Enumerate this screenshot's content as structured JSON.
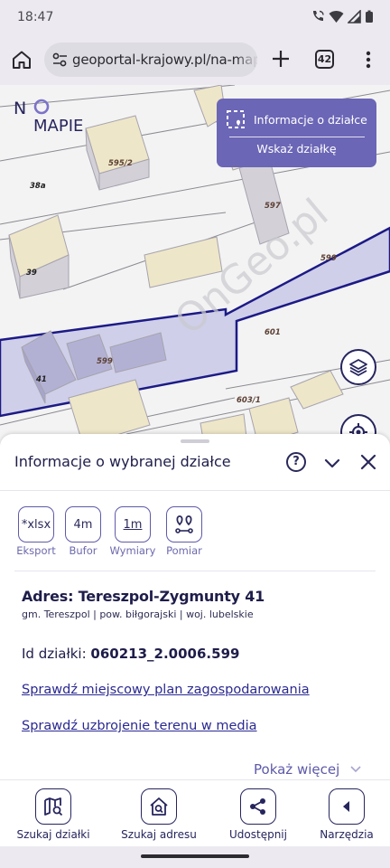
{
  "status_bar": {
    "time": "18:47"
  },
  "browser": {
    "url": "geoportal-krajowy.pl/na-mapie",
    "tab_count": "42"
  },
  "logo": {
    "line1": "N",
    "line1_rest": "",
    "line2": "MAPIE"
  },
  "map": {
    "labels": [
      "595/2",
      "38a",
      "597",
      "599",
      "39",
      "601",
      "41",
      "599",
      "603/1"
    ],
    "watermark": "OnGeo.pl",
    "info_button": "Informacje o działce",
    "select_button": "Wskaż działkę"
  },
  "sheet": {
    "title": "Informacje o wybranej działce",
    "help": "?",
    "tools": [
      {
        "icon_text": "*xlsx",
        "label": "Eksport"
      },
      {
        "icon_text": "4m",
        "label": "Bufor"
      },
      {
        "icon_text": "1m",
        "label": "Wymiary"
      },
      {
        "icon_text": "",
        "label": "Pomiar"
      }
    ],
    "address": "Adres: Tereszpol-Zygmunty 41",
    "address_sub": "gm. Tereszpol | pow. biłgorajski | woj. lubelskie",
    "parcel_id_label": "Id działki:",
    "parcel_id_value": "060213_2.0006.599",
    "link_plan": "Sprawdź miejscowy plan zagospodarowania",
    "link_media": "Sprawdź uzbrojenie terenu w media",
    "show_more": "Pokaż więcej"
  },
  "bottom_nav": [
    {
      "label": "Szukaj działki",
      "icon": "map-search-icon"
    },
    {
      "label": "Szukaj adresu",
      "icon": "home-search-icon"
    },
    {
      "label": "Udostępnij",
      "icon": "share-icon"
    },
    {
      "label": "Narzędzia",
      "icon": "chevron-left-icon"
    }
  ],
  "colors": {
    "accent": "#6b66b6",
    "navy": "#26255e",
    "parcel_fill": "#c5c6e6",
    "parcel_outline": "#1c1a86",
    "building": "#efe6c8"
  }
}
